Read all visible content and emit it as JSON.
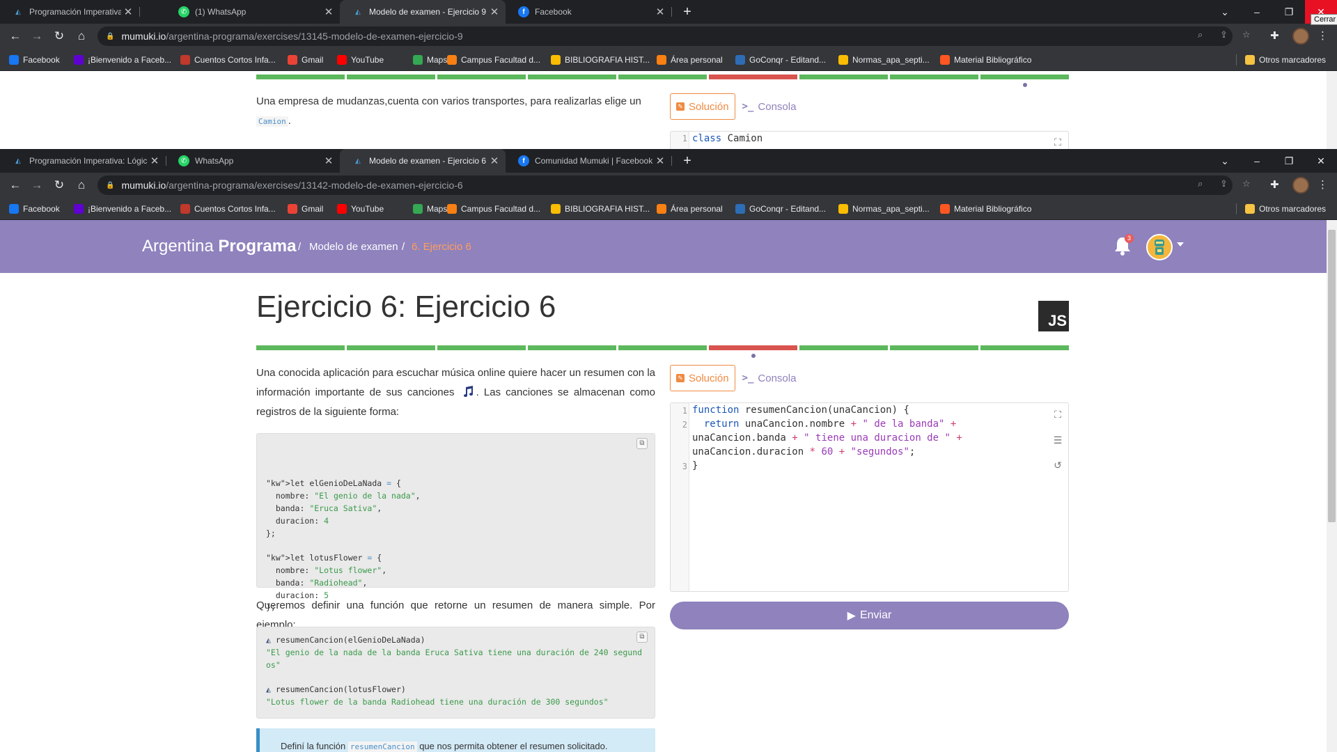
{
  "window_back": {
    "tabs": [
      {
        "title": "Programación Imperativa: Lógica",
        "icon": "mumuki-icon"
      },
      {
        "title": "(1) WhatsApp",
        "icon": "whatsapp-icon"
      },
      {
        "title": "Modelo de examen - Ejercicio 9",
        "icon": "mumuki-icon"
      },
      {
        "title": "Facebook",
        "icon": "facebook-icon"
      }
    ],
    "url_host": "mumuki.io",
    "url_path": "/argentina-programa/exercises/13145-modelo-de-examen-ejercicio-9",
    "close_tooltip": "Cerrar",
    "desc_text": "Una empresa de mudanzas,cuenta con varios transportes, para realizarlas elige un",
    "desc_code": "Camion",
    "desc_end": ".",
    "tab_solution": "Solución",
    "tab_console": "Consola",
    "editor_line_no": "1",
    "editor_kw": "class",
    "editor_name": " Camion"
  },
  "window_front": {
    "tabs": [
      {
        "title": "Programación Imperativa: Lógica",
        "icon": "mumuki-icon"
      },
      {
        "title": "WhatsApp",
        "icon": "whatsapp-icon"
      },
      {
        "title": "Modelo de examen - Ejercicio 6",
        "icon": "mumuki-icon"
      },
      {
        "title": "Comunidad Mumuki | Facebook",
        "icon": "facebook-icon"
      }
    ],
    "url_host": "mumuki.io",
    "url_path": "/argentina-programa/exercises/13142-modelo-de-examen-ejercicio-6"
  },
  "bookmarks": [
    {
      "label": "Facebook",
      "icon": "facebook-icon",
      "color": "#1877f2"
    },
    {
      "label": "¡Bienvenido a Faceb...",
      "icon": "yahoo-icon",
      "color": "#6001d2"
    },
    {
      "label": "Cuentos Cortos Infa...",
      "icon": "book-icon",
      "color": "#c0392b"
    },
    {
      "label": "Gmail",
      "icon": "gmail-icon",
      "color": "#ea4335"
    },
    {
      "label": "YouTube",
      "icon": "youtube-icon",
      "color": "#ff0000"
    },
    {
      "label": "Maps",
      "icon": "maps-icon",
      "color": "#34a853"
    },
    {
      "label": "Campus Facultad d...",
      "icon": "moodle-icon",
      "color": "#f98012"
    },
    {
      "label": "BIBLIOGRAFIA HIST...",
      "icon": "drive-icon",
      "color": "#fbbc04"
    },
    {
      "label": "Área personal",
      "icon": "moodle-icon",
      "color": "#f98012"
    },
    {
      "label": "GoConqr - Editand...",
      "icon": "goconqr-icon",
      "color": "#2d6db5"
    },
    {
      "label": "Normas_apa_septi...",
      "icon": "drive-icon",
      "color": "#fbbc04"
    },
    {
      "label": "Material Bibliográfico",
      "icon": "blogger-icon",
      "color": "#ff5722"
    }
  ],
  "other_bookmarks": "Otros marcadores",
  "site": {
    "brand_light": "Argentina",
    "brand_bold": "Programa",
    "breadcrumb": [
      "Modelo de examen",
      "6. Ejercicio 6"
    ],
    "notifications": "3",
    "colors": {
      "navbar": "#8f82bd",
      "accent": "#f08a40",
      "success": "#5cb85c",
      "fail": "#d9534f"
    }
  },
  "exercise": {
    "title": "Ejercicio 6: Ejercicio 6",
    "language_badge": "JS",
    "progress": [
      "passed",
      "passed",
      "passed",
      "passed",
      "passed",
      "failed",
      "passed",
      "passed",
      "passed"
    ],
    "current_index": 5,
    "intro_1": "Una conocida aplicación para escuchar música online quiere hacer un resumen con la información importante de sus canciones",
    "intro_2": ". Las canciones se almacenan como registros de la siguiente forma:",
    "records_code": [
      "let elGenioDeLaNada = {",
      "  nombre: \"El genio de la nada\",",
      "  banda: \"Eruca Sativa\",",
      "  duracion: 4",
      "};",
      "",
      "let lotusFlower = {",
      "  nombre: \"Lotus flower\",",
      "  banda: \"Radiohead\",",
      "  duracion: 5",
      "};"
    ],
    "example_intro": "Queremos definir una función que retorne un resumen de manera simple. Por ejemplo:",
    "example_calls": [
      {
        "call": "resumenCancion(elGenioDeLaNada)",
        "result": "\"El genio de la nada de la banda Eruca Sativa tiene una duración de 240 segund",
        "result_cont": "os\""
      },
      {
        "call": "resumenCancion(lotusFlower)",
        "result": "\"Lotus flower de la banda Radiohead tiene una duración de 300 segundos\"",
        "result_cont": ""
      }
    ],
    "task_pre": "Definí la función",
    "task_code": "resumenCancion",
    "task_post": "que nos permita obtener el resumen solicitado.",
    "tab_solution": "Solución",
    "tab_console": "Consola",
    "editor_lines": [
      "1",
      "2",
      "",
      "",
      "3"
    ],
    "submit_label": "Enviar"
  }
}
